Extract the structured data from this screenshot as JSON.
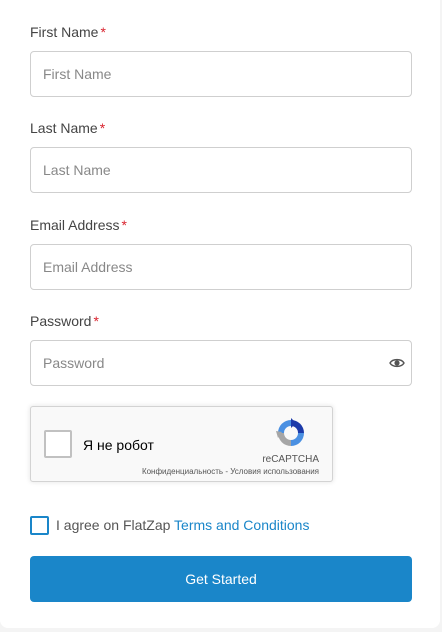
{
  "form": {
    "first_name": {
      "label": "First Name",
      "required_mark": "*",
      "placeholder": "First Name",
      "value": ""
    },
    "last_name": {
      "label": "Last Name",
      "required_mark": "*",
      "placeholder": "Last Name",
      "value": ""
    },
    "email": {
      "label": "Email Address",
      "required_mark": "*",
      "placeholder": "Email Address",
      "value": ""
    },
    "password": {
      "label": "Password",
      "required_mark": "*",
      "placeholder": "Password",
      "value": "",
      "toggle_icon": "eye-icon"
    }
  },
  "captcha": {
    "checkbox_label": "Я не робот",
    "brand": "reCAPTCHA",
    "privacy_link": "Конфиденциальность",
    "separator": " - ",
    "terms_link": "Условия использования",
    "icon": "recaptcha-logo-icon"
  },
  "agreement": {
    "text": "I agree on FlatZap",
    "link": "Terms and Conditions",
    "checked": false
  },
  "submit": {
    "label": "Get Started"
  },
  "colors": {
    "accent": "#1a86c9",
    "required": "#d9232e"
  }
}
